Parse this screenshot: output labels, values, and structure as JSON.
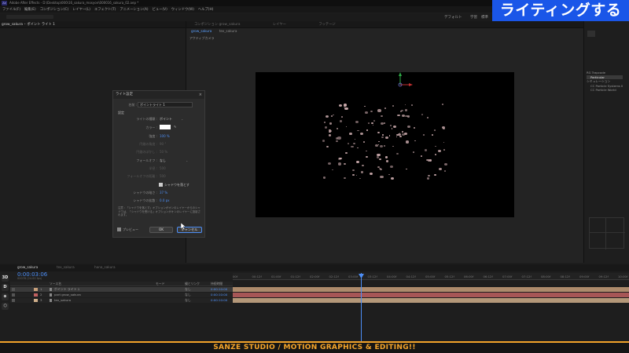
{
  "window": {
    "title": "Adobe After Effects - D:\\Desktop\\000\\16_sakura_mosyon\\000016_sakura_02.aep *",
    "app_icon": "Ae"
  },
  "menu": [
    "ファイル(F)",
    "編集(E)",
    "コンポジション(C)",
    "レイヤー(L)",
    "エフェクト(T)",
    "アニメーション(A)",
    "ビュー(V)",
    "ウィンドウ(W)",
    "ヘルプ(H)"
  ],
  "workspace": {
    "default": "デフォルト",
    "learn": "学習",
    "standard": "標準"
  },
  "banner": {
    "text": "ライティングする",
    "color": "#1a56e8"
  },
  "left_panel": {
    "tabs": [
      "grow_sakura",
      "ポイント ライト 1"
    ]
  },
  "comp_panel": {
    "tabs": [
      "コンポジション grow_sakura",
      "レイヤー",
      "フッテージ"
    ],
    "subtabs": [
      "grow_sakura",
      "tex_sakura"
    ],
    "view_label": "アクティブカメラ"
  },
  "right_panel": {
    "items": [
      "RG Trapcode",
      "Particular",
      "シミュレーション",
      "CC Particle Systems II",
      "CC Particle World"
    ]
  },
  "dialog": {
    "title": "ライト設定",
    "close": "×",
    "name_label": "名前 :",
    "name_value": "ポイントライト 1",
    "section": "設定",
    "light_type_label": "ライトの種類 :",
    "light_type_value": "ポイント",
    "color_label": "カラー :",
    "intensity_label": "強度 :",
    "intensity_value": "100 %",
    "cone_angle_label": "円錐の角度 :",
    "cone_angle_value": "90 °",
    "cone_feather_label": "円錐のぼかし :",
    "cone_feather_value": "50 %",
    "falloff_label": "フォールオフ :",
    "falloff_value": "なし",
    "radius_label": "半径 :",
    "radius_value": "500",
    "falloff_distance_label": "フォールオフの距離 :",
    "falloff_distance_value": "500",
    "casts_shadows": "シャドウを落とす",
    "shadow_darkness_label": "シャドウの暗さ :",
    "shadow_darkness_value": "37 %",
    "shadow_diffusion_label": "シャドウの拡散 :",
    "shadow_diffusion_value": "0.0 px",
    "note": "注意 : 「シャドウを落とす」オプションがオンのレイヤーからのシャドウは、「シャドウを受ける」オプションがオンのレイヤーに投影されます。",
    "preview": "プレビュー",
    "ok": "OK",
    "cancel": "キャンセル"
  },
  "timeline": {
    "tabs": [
      "grow_sakura",
      "tex_sakura",
      "hana_sakura"
    ],
    "timecode": "0:00:03:06",
    "timecode_sub": "00078 (24.00 fps)",
    "col_source": "ソース名",
    "col_parent": "親とリンク",
    "col_mode": "モード",
    "col_duration": "持続時間",
    "ruler": [
      "00f",
      "00:12f",
      "01:00f",
      "01:12f",
      "02:00f",
      "02:12f",
      "03:00f",
      "03:12f",
      "04:00f",
      "04:12f",
      "05:00f",
      "05:12f",
      "06:00f",
      "06:12f",
      "07:00f",
      "07:12f",
      "08:00f",
      "08:12f",
      "09:00f",
      "09:12f",
      "10:00f"
    ],
    "layers": [
      {
        "num": "1",
        "name": "ポイント ライト 1",
        "parent": "なし",
        "dur": "0:00:10:00",
        "color": "#c79f7a"
      },
      {
        "num": "2",
        "name": "part grow_sakura",
        "parent": "なし",
        "dur": "0:00:10:00",
        "color": "#c06060"
      },
      {
        "num": "3",
        "name": "tex_sakura",
        "parent": "なし",
        "dur": "0:00:10:00",
        "color": "#cfae8a"
      }
    ]
  },
  "left_tools": [
    "3D",
    "D",
    "⊕",
    "⬡"
  ],
  "footer": "SANZE STUDIO  / MOTION GRAPHICS & EDITING!!"
}
